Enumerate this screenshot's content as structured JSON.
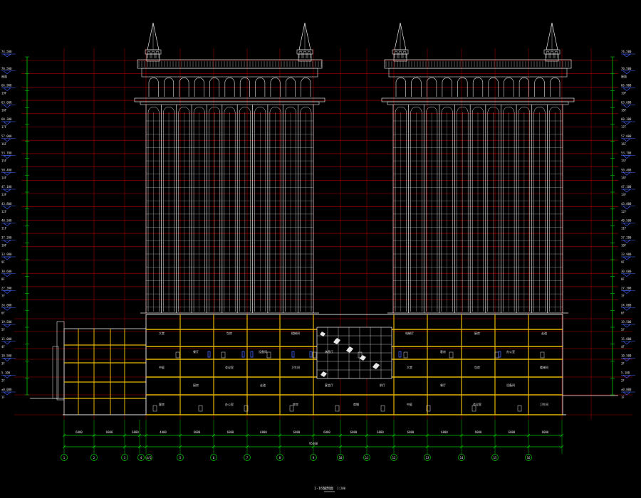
{
  "colors": {
    "background": "#000000",
    "tower": "#e6e6e6",
    "grid": "#b40000",
    "structure": "#e6b400",
    "dimension": "#00cc00",
    "level_marker": "#4466ff",
    "leader": "#00dddd",
    "text": "#e0e0e0"
  },
  "axes": [
    "1",
    "2",
    "3",
    "4",
    "4/5",
    "5",
    "6",
    "7",
    "8",
    "9",
    "10",
    "11",
    "12",
    "13",
    "14",
    "15",
    "16"
  ],
  "overall_dimension": "95400",
  "bay_dimensions": [
    "6000",
    "6000",
    "6000",
    "4000",
    "6000",
    "6000",
    "6000",
    "6000",
    "6000",
    "6000",
    "6000",
    "6000",
    "6000",
    "6000",
    "6000",
    "6000"
  ],
  "title_block": {
    "title": "1-16轴剖面",
    "scale": "1:200"
  },
  "levels": [
    {
      "elev": "74.500",
      "name": ""
    },
    {
      "elev": "70.500",
      "name": "屋面"
    },
    {
      "elev": "66.900",
      "name": "19F"
    },
    {
      "elev": "63.600",
      "name": "18F"
    },
    {
      "elev": "60.300",
      "name": "17F"
    },
    {
      "elev": "57.000",
      "name": "16F"
    },
    {
      "elev": "53.700",
      "name": "15F"
    },
    {
      "elev": "50.400",
      "name": "14F"
    },
    {
      "elev": "47.100",
      "name": "13F"
    },
    {
      "elev": "43.800",
      "name": "12F"
    },
    {
      "elev": "40.500",
      "name": "11F"
    },
    {
      "elev": "37.200",
      "name": "10F"
    },
    {
      "elev": "33.900",
      "name": "9F"
    },
    {
      "elev": "30.600",
      "name": "8F"
    },
    {
      "elev": "27.300",
      "name": "7F"
    },
    {
      "elev": "24.000",
      "name": "6F"
    },
    {
      "elev": "19.500",
      "name": "5F"
    },
    {
      "elev": "15.000",
      "name": "4F"
    },
    {
      "elev": "10.500",
      "name": "3F"
    },
    {
      "elev": "5.100",
      "name": "2F"
    },
    {
      "elev": "±0.000",
      "name": "1F"
    }
  ],
  "rooms": [
    "大堂",
    "中庭",
    "客房",
    "餐厅",
    "厨房",
    "包房",
    "会议室",
    "办公室",
    "设备间",
    "走道",
    "楼梯间",
    "卫生间",
    "库房",
    "休息厅",
    "宴会厅",
    "商铺",
    "前厅",
    "电梯厅"
  ]
}
